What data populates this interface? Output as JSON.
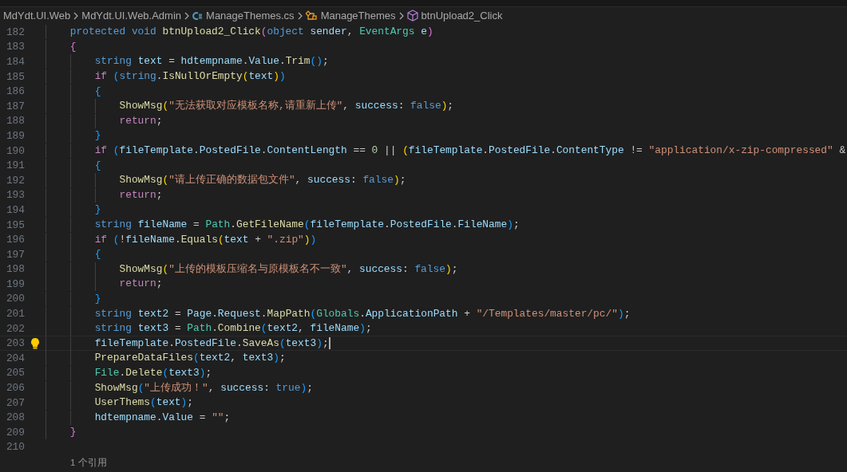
{
  "breadcrumb": [
    {
      "kind": "folder",
      "label": "MdYdt.UI.Web"
    },
    {
      "kind": "folder",
      "label": "MdYdt.UI.Web.Admin"
    },
    {
      "kind": "file",
      "label": "ManageThemes.cs"
    },
    {
      "kind": "class",
      "label": "ManageThemes"
    },
    {
      "kind": "method",
      "label": "btnUpload2_Click"
    }
  ],
  "lines": [
    {
      "number": "182",
      "current": false,
      "tokens": [
        {
          "kind": "kw",
          "text": "    protected void "
        },
        {
          "kind": "fn",
          "text": "btnUpload2_Click"
        },
        {
          "kind": "b2",
          "text": "("
        },
        {
          "kind": "kw",
          "text": "object "
        },
        {
          "kind": "var",
          "text": "sender"
        },
        {
          "kind": "p",
          "text": ", "
        },
        {
          "kind": "type",
          "text": "EventArgs "
        },
        {
          "kind": "var",
          "text": "e"
        },
        {
          "kind": "b2",
          "text": ")"
        }
      ]
    },
    {
      "number": "183",
      "current": false,
      "tokens": [
        {
          "kind": "b2",
          "text": "    {"
        }
      ]
    },
    {
      "number": "184",
      "current": false,
      "tokens": [
        {
          "kind": "kw",
          "text": "        string "
        },
        {
          "kind": "var",
          "text": "text"
        },
        {
          "kind": "p",
          "text": " = "
        },
        {
          "kind": "var",
          "text": "hdtempname"
        },
        {
          "kind": "p",
          "text": "."
        },
        {
          "kind": "var",
          "text": "Value"
        },
        {
          "kind": "p",
          "text": "."
        },
        {
          "kind": "fn",
          "text": "Trim"
        },
        {
          "kind": "b3",
          "text": "()"
        },
        {
          "kind": "p",
          "text": ";"
        }
      ]
    },
    {
      "number": "185",
      "current": false,
      "tokens": [
        {
          "kind": "ctl",
          "text": "        if "
        },
        {
          "kind": "b3",
          "text": "("
        },
        {
          "kind": "kw",
          "text": "string"
        },
        {
          "kind": "p",
          "text": "."
        },
        {
          "kind": "fn",
          "text": "IsNullOrEmpty"
        },
        {
          "kind": "b1",
          "text": "("
        },
        {
          "kind": "var",
          "text": "text"
        },
        {
          "kind": "b1",
          "text": ")"
        },
        {
          "kind": "b3",
          "text": ")"
        }
      ]
    },
    {
      "number": "186",
      "current": false,
      "tokens": [
        {
          "kind": "b3",
          "text": "        {"
        }
      ]
    },
    {
      "number": "187",
      "current": false,
      "tokens": [
        {
          "kind": "fn",
          "text": "            ShowMsg"
        },
        {
          "kind": "b1",
          "text": "("
        },
        {
          "kind": "str",
          "text": "\"无法获取对应模板名称,请重新上传\""
        },
        {
          "kind": "p",
          "text": ", "
        },
        {
          "kind": "var",
          "text": "success"
        },
        {
          "kind": "p",
          "text": ": "
        },
        {
          "kind": "kw",
          "text": "false"
        },
        {
          "kind": "b1",
          "text": ")"
        },
        {
          "kind": "p",
          "text": ";"
        }
      ]
    },
    {
      "number": "188",
      "current": false,
      "tokens": [
        {
          "kind": "ctl",
          "text": "            return"
        },
        {
          "kind": "p",
          "text": ";"
        }
      ]
    },
    {
      "number": "189",
      "current": false,
      "tokens": [
        {
          "kind": "b3",
          "text": "        }"
        }
      ]
    },
    {
      "number": "190",
      "current": false,
      "tokens": [
        {
          "kind": "ctl",
          "text": "        if "
        },
        {
          "kind": "b3",
          "text": "("
        },
        {
          "kind": "var",
          "text": "fileTemplate"
        },
        {
          "kind": "p",
          "text": "."
        },
        {
          "kind": "var",
          "text": "PostedFile"
        },
        {
          "kind": "p",
          "text": "."
        },
        {
          "kind": "var",
          "text": "ContentLength"
        },
        {
          "kind": "p",
          "text": " == "
        },
        {
          "kind": "num",
          "text": "0"
        },
        {
          "kind": "p",
          "text": " || "
        },
        {
          "kind": "b1",
          "text": "("
        },
        {
          "kind": "var",
          "text": "fileTemplate"
        },
        {
          "kind": "p",
          "text": "."
        },
        {
          "kind": "var",
          "text": "PostedFile"
        },
        {
          "kind": "p",
          "text": "."
        },
        {
          "kind": "var",
          "text": "ContentType"
        },
        {
          "kind": "p",
          "text": " != "
        },
        {
          "kind": "str",
          "text": "\"application/x-zip-compressed\""
        },
        {
          "kind": "p",
          "text": " &"
        }
      ]
    },
    {
      "number": "191",
      "current": false,
      "tokens": [
        {
          "kind": "b3",
          "text": "        {"
        }
      ]
    },
    {
      "number": "192",
      "current": false,
      "tokens": [
        {
          "kind": "fn",
          "text": "            ShowMsg"
        },
        {
          "kind": "b1",
          "text": "("
        },
        {
          "kind": "str",
          "text": "\"请上传正确的数据包文件\""
        },
        {
          "kind": "p",
          "text": ", "
        },
        {
          "kind": "var",
          "text": "success"
        },
        {
          "kind": "p",
          "text": ": "
        },
        {
          "kind": "kw",
          "text": "false"
        },
        {
          "kind": "b1",
          "text": ")"
        },
        {
          "kind": "p",
          "text": ";"
        }
      ]
    },
    {
      "number": "193",
      "current": false,
      "tokens": [
        {
          "kind": "ctl",
          "text": "            return"
        },
        {
          "kind": "p",
          "text": ";"
        }
      ]
    },
    {
      "number": "194",
      "current": false,
      "tokens": [
        {
          "kind": "b3",
          "text": "        }"
        }
      ]
    },
    {
      "number": "195",
      "current": false,
      "tokens": [
        {
          "kind": "kw",
          "text": "        string "
        },
        {
          "kind": "var",
          "text": "fileName"
        },
        {
          "kind": "p",
          "text": " = "
        },
        {
          "kind": "type",
          "text": "Path"
        },
        {
          "kind": "p",
          "text": "."
        },
        {
          "kind": "fn",
          "text": "GetFileName"
        },
        {
          "kind": "b3",
          "text": "("
        },
        {
          "kind": "var",
          "text": "fileTemplate"
        },
        {
          "kind": "p",
          "text": "."
        },
        {
          "kind": "var",
          "text": "PostedFile"
        },
        {
          "kind": "p",
          "text": "."
        },
        {
          "kind": "var",
          "text": "FileName"
        },
        {
          "kind": "b3",
          "text": ")"
        },
        {
          "kind": "p",
          "text": ";"
        }
      ]
    },
    {
      "number": "196",
      "current": false,
      "tokens": [
        {
          "kind": "ctl",
          "text": "        if "
        },
        {
          "kind": "b3",
          "text": "("
        },
        {
          "kind": "p",
          "text": "!"
        },
        {
          "kind": "var",
          "text": "fileName"
        },
        {
          "kind": "p",
          "text": "."
        },
        {
          "kind": "fn",
          "text": "Equals"
        },
        {
          "kind": "b1",
          "text": "("
        },
        {
          "kind": "var",
          "text": "text"
        },
        {
          "kind": "p",
          "text": " + "
        },
        {
          "kind": "str",
          "text": "\".zip\""
        },
        {
          "kind": "b1",
          "text": ")"
        },
        {
          "kind": "b3",
          "text": ")"
        }
      ]
    },
    {
      "number": "197",
      "current": false,
      "tokens": [
        {
          "kind": "b3",
          "text": "        {"
        }
      ]
    },
    {
      "number": "198",
      "current": false,
      "tokens": [
        {
          "kind": "fn",
          "text": "            ShowMsg"
        },
        {
          "kind": "b1",
          "text": "("
        },
        {
          "kind": "str",
          "text": "\"上传的模板压缩名与原模板名不一致\""
        },
        {
          "kind": "p",
          "text": ", "
        },
        {
          "kind": "var",
          "text": "success"
        },
        {
          "kind": "p",
          "text": ": "
        },
        {
          "kind": "kw",
          "text": "false"
        },
        {
          "kind": "b1",
          "text": ")"
        },
        {
          "kind": "p",
          "text": ";"
        }
      ]
    },
    {
      "number": "199",
      "current": false,
      "tokens": [
        {
          "kind": "ctl",
          "text": "            return"
        },
        {
          "kind": "p",
          "text": ";"
        }
      ]
    },
    {
      "number": "200",
      "current": false,
      "tokens": [
        {
          "kind": "b3",
          "text": "        }"
        }
      ]
    },
    {
      "number": "201",
      "current": false,
      "tokens": [
        {
          "kind": "kw",
          "text": "        string "
        },
        {
          "kind": "var",
          "text": "text2"
        },
        {
          "kind": "p",
          "text": " = "
        },
        {
          "kind": "var",
          "text": "Page"
        },
        {
          "kind": "p",
          "text": "."
        },
        {
          "kind": "var",
          "text": "Request"
        },
        {
          "kind": "p",
          "text": "."
        },
        {
          "kind": "fn",
          "text": "MapPath"
        },
        {
          "kind": "b3",
          "text": "("
        },
        {
          "kind": "type",
          "text": "Globals"
        },
        {
          "kind": "p",
          "text": "."
        },
        {
          "kind": "var",
          "text": "ApplicationPath"
        },
        {
          "kind": "p",
          "text": " + "
        },
        {
          "kind": "str",
          "text": "\"/Templates/master/pc/\""
        },
        {
          "kind": "b3",
          "text": ")"
        },
        {
          "kind": "p",
          "text": ";"
        }
      ]
    },
    {
      "number": "202",
      "current": false,
      "tokens": [
        {
          "kind": "kw",
          "text": "        string "
        },
        {
          "kind": "var",
          "text": "text3"
        },
        {
          "kind": "p",
          "text": " = "
        },
        {
          "kind": "type",
          "text": "Path"
        },
        {
          "kind": "p",
          "text": "."
        },
        {
          "kind": "fn",
          "text": "Combine"
        },
        {
          "kind": "b3",
          "text": "("
        },
        {
          "kind": "var",
          "text": "text2"
        },
        {
          "kind": "p",
          "text": ", "
        },
        {
          "kind": "var",
          "text": "fileName"
        },
        {
          "kind": "b3",
          "text": ")"
        },
        {
          "kind": "p",
          "text": ";"
        }
      ]
    },
    {
      "number": "203",
      "current": true,
      "tokens": [
        {
          "kind": "var",
          "text": "        fileTemplate"
        },
        {
          "kind": "p",
          "text": "."
        },
        {
          "kind": "var",
          "text": "PostedFile"
        },
        {
          "kind": "p",
          "text": "."
        },
        {
          "kind": "fn",
          "text": "SaveAs"
        },
        {
          "kind": "b3",
          "text": "("
        },
        {
          "kind": "var",
          "text": "text3"
        },
        {
          "kind": "b3",
          "text": ")"
        },
        {
          "kind": "p",
          "text": ";"
        }
      ]
    },
    {
      "number": "204",
      "current": false,
      "tokens": [
        {
          "kind": "fn",
          "text": "        PrepareDataFiles"
        },
        {
          "kind": "b3",
          "text": "("
        },
        {
          "kind": "var",
          "text": "text2"
        },
        {
          "kind": "p",
          "text": ", "
        },
        {
          "kind": "var",
          "text": "text3"
        },
        {
          "kind": "b3",
          "text": ")"
        },
        {
          "kind": "p",
          "text": ";"
        }
      ]
    },
    {
      "number": "205",
      "current": false,
      "tokens": [
        {
          "kind": "type",
          "text": "        File"
        },
        {
          "kind": "p",
          "text": "."
        },
        {
          "kind": "fn",
          "text": "Delete"
        },
        {
          "kind": "b3",
          "text": "("
        },
        {
          "kind": "var",
          "text": "text3"
        },
        {
          "kind": "b3",
          "text": ")"
        },
        {
          "kind": "p",
          "text": ";"
        }
      ]
    },
    {
      "number": "206",
      "current": false,
      "tokens": [
        {
          "kind": "fn",
          "text": "        ShowMsg"
        },
        {
          "kind": "b3",
          "text": "("
        },
        {
          "kind": "str",
          "text": "\"上传成功！\""
        },
        {
          "kind": "p",
          "text": ", "
        },
        {
          "kind": "var",
          "text": "success"
        },
        {
          "kind": "p",
          "text": ": "
        },
        {
          "kind": "kw",
          "text": "true"
        },
        {
          "kind": "b3",
          "text": ")"
        },
        {
          "kind": "p",
          "text": ";"
        }
      ]
    },
    {
      "number": "207",
      "current": false,
      "tokens": [
        {
          "kind": "fn",
          "text": "        UserThems"
        },
        {
          "kind": "b3",
          "text": "("
        },
        {
          "kind": "var",
          "text": "text"
        },
        {
          "kind": "b3",
          "text": ")"
        },
        {
          "kind": "p",
          "text": ";"
        }
      ]
    },
    {
      "number": "208",
      "current": false,
      "tokens": [
        {
          "kind": "var",
          "text": "        hdtempname"
        },
        {
          "kind": "p",
          "text": "."
        },
        {
          "kind": "var",
          "text": "Value"
        },
        {
          "kind": "p",
          "text": " = "
        },
        {
          "kind": "str",
          "text": "\"\""
        },
        {
          "kind": "p",
          "text": ";"
        }
      ]
    },
    {
      "number": "209",
      "current": false,
      "tokens": [
        {
          "kind": "b2",
          "text": "    }"
        }
      ]
    },
    {
      "number": "210",
      "current": false
    }
  ],
  "codelens": "1 个引用"
}
